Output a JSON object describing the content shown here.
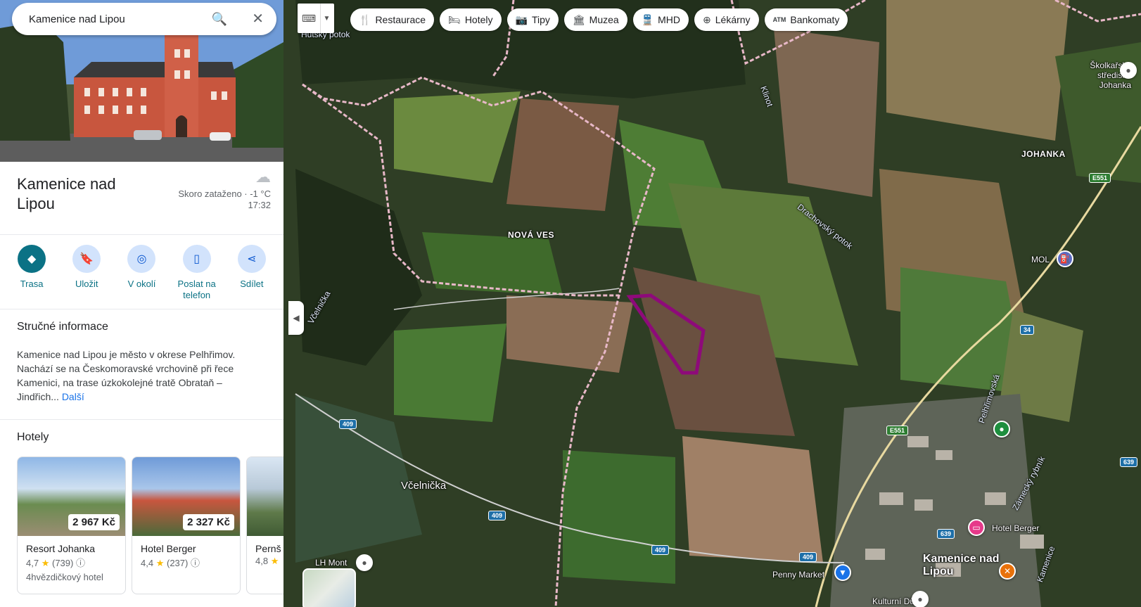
{
  "search": {
    "value": "Kamenice nad Lipou"
  },
  "place": {
    "title": "Kamenice nad Lipou",
    "weather": {
      "condition": "Skoro zataženo · -1 °C",
      "time": "17:32"
    }
  },
  "actions": [
    {
      "label": "Trasa"
    },
    {
      "label": "Uložit"
    },
    {
      "label": "V okolí"
    },
    {
      "label": "Poslat na telefon"
    },
    {
      "label": "Sdílet"
    }
  ],
  "summary": {
    "heading": "Stručné informace",
    "text": "Kamenice nad Lipou je město v okrese Pelhřimov. Nachází se na Českomoravské vrchovině při řece Kamenici, na trase úzkokolejné tratě Obrataň – Jindřich...",
    "more": "Další"
  },
  "hotels": {
    "heading": "Hotely",
    "items": [
      {
        "name": "Resort Johanka",
        "price": "2 967 Kč",
        "rating": "4,7",
        "reviews": "(739)",
        "class": "4hvězdičkový hotel"
      },
      {
        "name": "Hotel Berger",
        "price": "2 327 Kč",
        "rating": "4,4",
        "reviews": "(237)",
        "class": ""
      },
      {
        "name": "Pernš",
        "price": "",
        "rating": "4,8",
        "reviews": "",
        "class": ""
      }
    ]
  },
  "chips": [
    {
      "icon": "restaurant-icon",
      "label": "Restaurace"
    },
    {
      "icon": "hotel-icon",
      "label": "Hotely"
    },
    {
      "icon": "camera-icon",
      "label": "Tipy"
    },
    {
      "icon": "museum-icon",
      "label": "Muzea"
    },
    {
      "icon": "transit-icon",
      "label": "MHD"
    },
    {
      "icon": "pharmacy-icon",
      "label": "Lékárny"
    },
    {
      "icon": "atm-icon",
      "label": "Bankomaty"
    }
  ],
  "map": {
    "labels": {
      "hutsky": "Hutský potok",
      "klinot": "Klinot",
      "skolkarske": "Školkařské středisko Johanka",
      "johanka": "JOHANKA",
      "nova_ves": "NOVÁ VES",
      "drachovsky": "Drachovský potok",
      "mol": "MOL",
      "vcelnicka_stream": "Včelnička",
      "vcelnicka": "Včelnička",
      "pelhrimovska": "Pelhřimovská",
      "zamecky": "Zámecký rybník",
      "hotel_berger": "Hotel Berger",
      "kamenice_town": "Kamenice nad Lipou",
      "lh_mont": "LH Mont",
      "penny": "Penny Market",
      "kulturni": "Kulturní Dům",
      "kamenice_stream": "Kamenice"
    },
    "shields": {
      "e551a": "E551",
      "e551b": "E551",
      "r34": "34",
      "r409a": "409",
      "r409b": "409",
      "r409c": "409",
      "r409d": "409",
      "r639a": "639",
      "r639b": "639"
    },
    "accent": "#8e0a7a"
  }
}
